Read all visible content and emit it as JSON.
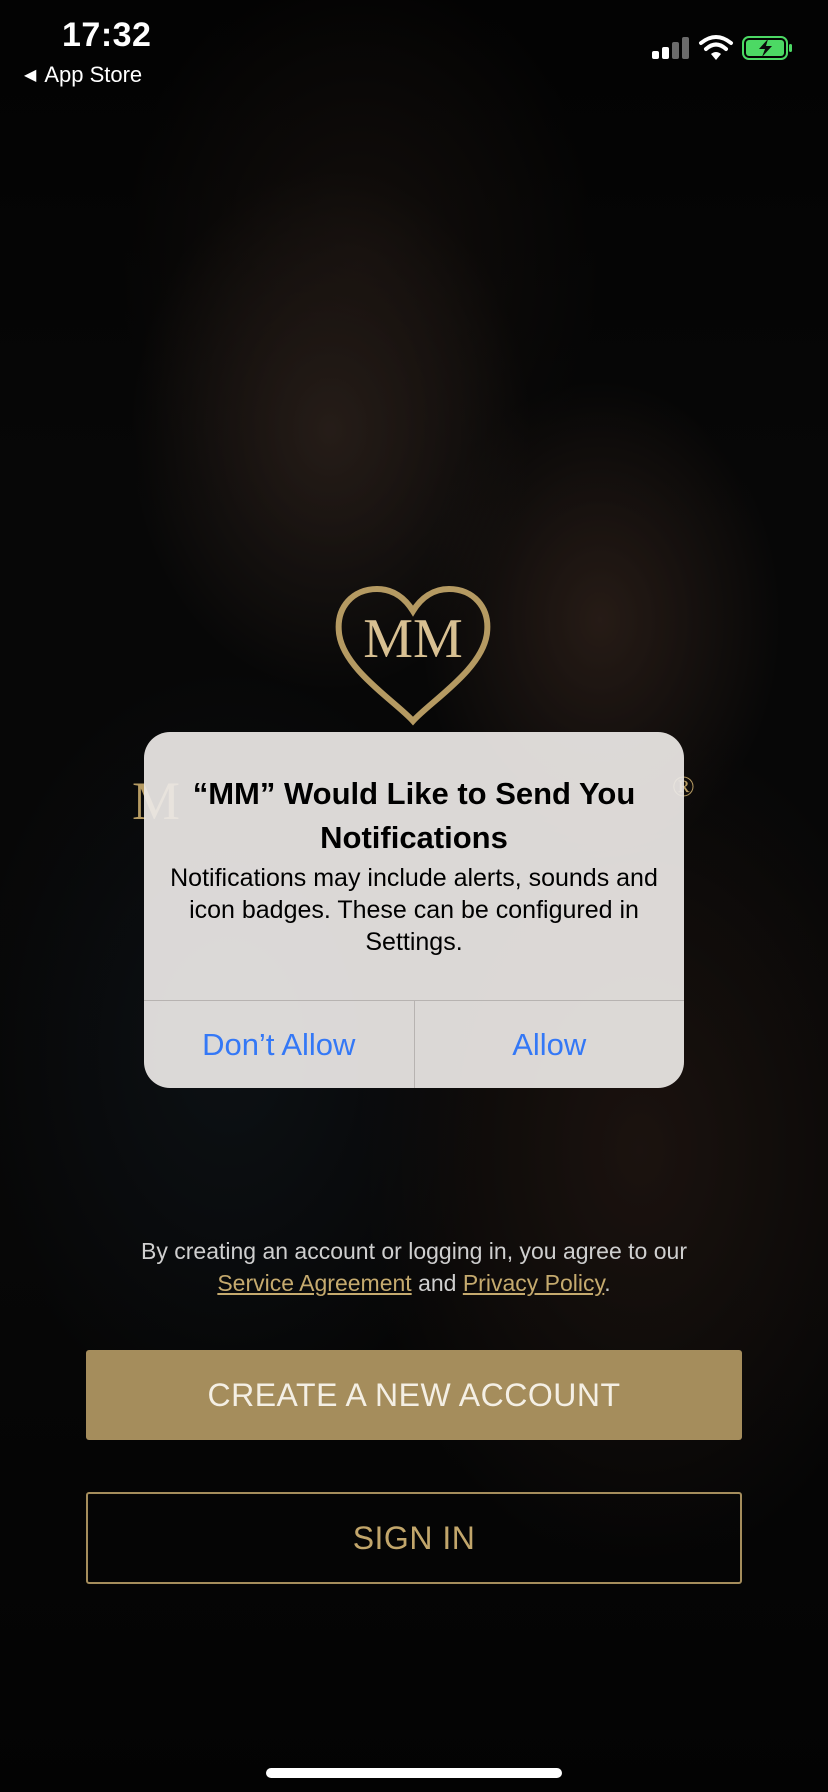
{
  "status_bar": {
    "time": "17:32",
    "back_label": "App Store"
  },
  "logo": {
    "monogram": "MM"
  },
  "alert": {
    "title": "“MM” Would Like to Send You Notifications",
    "message": "Notifications may include alerts, sounds and icon badges. These can be configured in Settings.",
    "dont_allow": "Don’t Allow",
    "allow": "Allow"
  },
  "legal": {
    "prefix": "By creating an account or logging in, you agree to our",
    "service_agreement": "Service Agreement",
    "and": "and",
    "privacy_policy": "Privacy Policy",
    "suffix": "."
  },
  "buttons": {
    "create_account": "CREATE A NEW ACCOUNT",
    "sign_in": "SIGN IN"
  },
  "colors": {
    "gold": "#a58d5c",
    "alert_blue": "#3478f6",
    "battery_green": "#4cd964"
  }
}
